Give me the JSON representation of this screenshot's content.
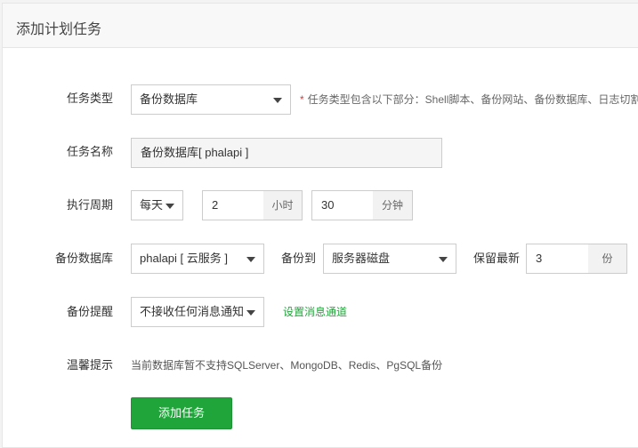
{
  "header": {
    "title": "添加计划任务"
  },
  "form": {
    "task_type": {
      "label": "任务类型",
      "value": "备份数据库",
      "hint_star": "*",
      "hint": "任务类型包含以下部分：Shell脚本、备份网站、备份数据库、日志切割"
    },
    "task_name": {
      "label": "任务名称",
      "value": "备份数据库[ phalapi ]"
    },
    "period": {
      "label": "执行周期",
      "frequency": "每天",
      "hour_value": "2",
      "hour_unit": "小时",
      "minute_value": "30",
      "minute_unit": "分钟"
    },
    "backup_db": {
      "label": "备份数据库",
      "db_value": "phalapi [ 云服务 ]",
      "dest_label": "备份到",
      "dest_value": "服务器磁盘",
      "keep_label": "保留最新",
      "keep_value": "3",
      "keep_unit": "份"
    },
    "notify": {
      "label": "备份提醒",
      "value": "不接收任何消息通知",
      "link": "设置消息通道"
    },
    "tip": {
      "label": "温馨提示",
      "text": "当前数据库暂不支持SQLServer、MongoDB、Redis、PgSQL备份"
    },
    "submit_label": "添加任务"
  }
}
